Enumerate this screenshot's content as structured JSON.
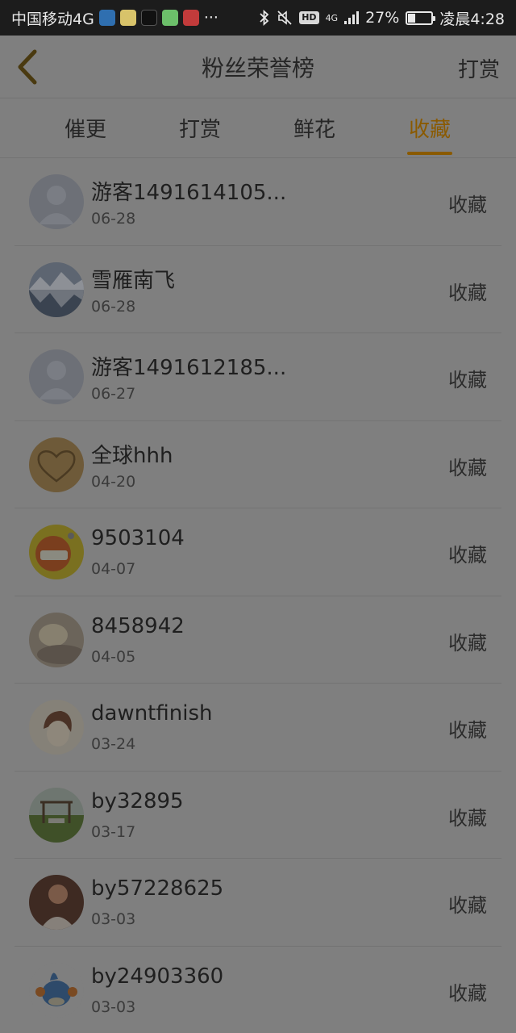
{
  "status_bar": {
    "carrier": "中国移动4G",
    "more": "···",
    "network": "4G",
    "battery": "27%",
    "time": "凌晨4:28"
  },
  "header": {
    "title": "粉丝荣誉榜",
    "right_link": "打赏"
  },
  "tabs": [
    {
      "label": "催更",
      "active": false
    },
    {
      "label": "打赏",
      "active": false
    },
    {
      "label": "鲜花",
      "active": false
    },
    {
      "label": "收藏",
      "active": true
    }
  ],
  "colors": {
    "overlay_bg": "#7f7f7f",
    "active_tab": "#8a5a00",
    "status_bar": "#1c1c1c"
  },
  "fans": [
    {
      "name": "游客1491614105...",
      "date": "06-28",
      "action": "收藏",
      "avatar": "default-avatar"
    },
    {
      "name": "雪雁南飞",
      "date": "06-28",
      "action": "收藏",
      "avatar": "landscape-avatar"
    },
    {
      "name": "游客1491612185...",
      "date": "06-27",
      "action": "收藏",
      "avatar": "default-avatar"
    },
    {
      "name": "全球hhh",
      "date": "04-20",
      "action": "收藏",
      "avatar": "heart-sand-avatar"
    },
    {
      "name": "9503104",
      "date": "04-07",
      "action": "收藏",
      "avatar": "cartoon-avatar"
    },
    {
      "name": "8458942",
      "date": "04-05",
      "action": "收藏",
      "avatar": "photo-avatar"
    },
    {
      "name": "dawntfinish",
      "date": "03-24",
      "action": "收藏",
      "avatar": "illustration-avatar"
    },
    {
      "name": "by32895",
      "date": "03-17",
      "action": "收藏",
      "avatar": "swing-avatar"
    },
    {
      "name": "by57228625",
      "date": "03-03",
      "action": "收藏",
      "avatar": "portrait-avatar"
    },
    {
      "name": "by24903360",
      "date": "03-03",
      "action": "收藏",
      "avatar": "pokemon-avatar"
    }
  ]
}
